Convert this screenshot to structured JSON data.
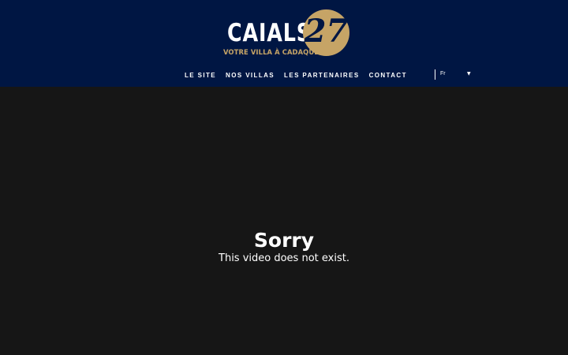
{
  "header": {
    "logo": {
      "word": "CAIALS",
      "badge_number": "27",
      "tagline": "VOTRE VILLA À CADAQUÈS"
    },
    "nav": [
      {
        "label": "LE SITE"
      },
      {
        "label": "NOS VILLAS"
      },
      {
        "label": "LES PARTENAIRES"
      },
      {
        "label": "CONTACT"
      }
    ],
    "language": {
      "selected": "Fr",
      "arrow_icon": "triangle-down-icon"
    }
  },
  "video": {
    "error_title": "Sorry",
    "error_message": "This video does not exist."
  },
  "colors": {
    "header_bg": "#001643",
    "accent_gold": "#c6a466",
    "video_bg": "#161616"
  }
}
